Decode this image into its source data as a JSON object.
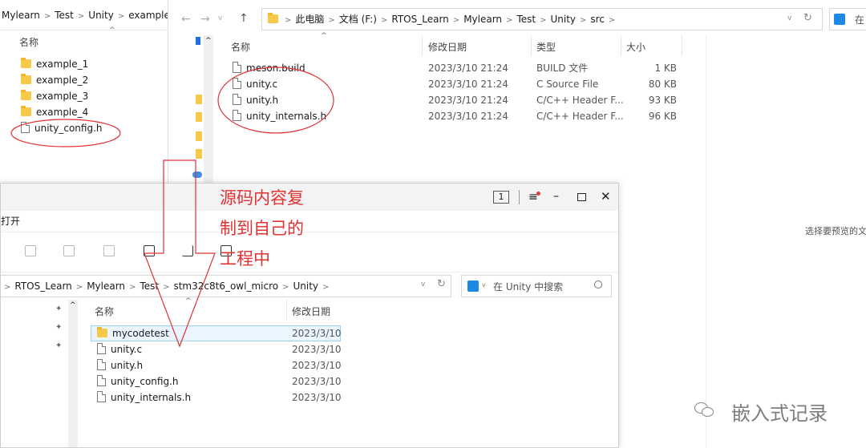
{
  "left_window": {
    "breadcrumb": [
      "Mylearn",
      "Test",
      "Unity",
      "examples"
    ],
    "column_header": "名称",
    "items": [
      {
        "name": "example_1",
        "type": "folder"
      },
      {
        "name": "example_2",
        "type": "folder"
      },
      {
        "name": "example_3",
        "type": "folder"
      },
      {
        "name": "example_4",
        "type": "folder"
      },
      {
        "name": "unity_config.h",
        "type": "file"
      }
    ]
  },
  "src_window": {
    "breadcrumb": [
      "此电脑",
      "文档 (F:)",
      "RTOS_Learn",
      "Mylearn",
      "Test",
      "Unity",
      "src"
    ],
    "search_placeholder": "在",
    "columns": {
      "name": "名称",
      "date": "修改日期",
      "type": "类型",
      "size": "大小"
    },
    "rows": [
      {
        "name": "meson.build",
        "date": "2023/3/10 21:24",
        "type": "BUILD 文件",
        "size": "1 KB"
      },
      {
        "name": "unity.c",
        "date": "2023/3/10 21:24",
        "type": "C Source File",
        "size": "80 KB"
      },
      {
        "name": "unity.h",
        "date": "2023/3/10 21:24",
        "type": "C/C++ Header F...",
        "size": "93 KB"
      },
      {
        "name": "unity_internals.h",
        "date": "2023/3/10 21:24",
        "type": "C/C++ Header F...",
        "size": "96 KB"
      }
    ],
    "preview_text": "选择要预览的文"
  },
  "front_window": {
    "title": "打开",
    "tab_count": "1",
    "breadcrumb": [
      "RTOS_Learn",
      "Mylearn",
      "Test",
      "stm32c8t6_owl_micro",
      "Unity"
    ],
    "search_placeholder": "在 Unity 中搜索",
    "columns": {
      "name": "名称",
      "date": "修改日期"
    },
    "rows": [
      {
        "name": "mycodetest",
        "type": "folder",
        "date": "2023/3/10"
      },
      {
        "name": "unity.c",
        "type": "file",
        "date": "2023/3/10"
      },
      {
        "name": "unity.h",
        "type": "file",
        "date": "2023/3/10"
      },
      {
        "name": "unity_config.h",
        "type": "file",
        "date": "2023/3/10"
      },
      {
        "name": "unity_internals.h",
        "type": "file",
        "date": "2023/3/10"
      }
    ]
  },
  "annotation": {
    "lines": [
      "源码内容复",
      "制到自己的",
      "工程中"
    ],
    "color": "#e23232"
  },
  "watermark": "嵌入式记录"
}
